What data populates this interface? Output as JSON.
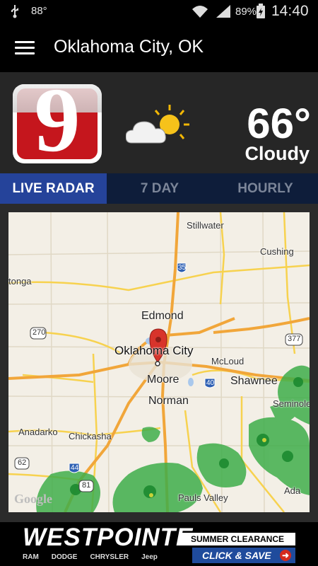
{
  "status_bar": {
    "temperature": "88°",
    "battery": "89%",
    "time": "14:40"
  },
  "app_bar": {
    "location": "Oklahoma City, OK"
  },
  "current": {
    "station_logo": "9",
    "temperature": "66°",
    "condition": "Cloudy",
    "icon": "partly-cloudy-icon"
  },
  "tabs": [
    {
      "label": "LIVE RADAR",
      "active": true
    },
    {
      "label": "7 DAY",
      "active": false
    },
    {
      "label": "HOURLY",
      "active": false
    }
  ],
  "map": {
    "labels": {
      "stillwater": "Stillwater",
      "cushing": "Cushing",
      "tonga": "tonga",
      "edmond": "Edmond",
      "okc": "Oklahoma City",
      "mcloud": "McLoud",
      "shawnee": "Shawnee",
      "moore": "Moore",
      "norman": "Norman",
      "seminole": "Seminole",
      "anadarko": "Anadarko",
      "chickasha": "Chickasha",
      "pauls_valley": "Pauls Valley",
      "ada": "Ada",
      "google": "Google"
    },
    "shields": {
      "i35": "35",
      "us270": "270",
      "us377": "377",
      "i40": "40",
      "us62": "62",
      "i44": "44",
      "us81": "81"
    }
  },
  "ad": {
    "brand": "WESTPOINTE",
    "makes": [
      "RAM",
      "DODGE",
      "CHRYSLER",
      "Jeep"
    ],
    "event": "SUMMER CLEARANCE EVENT",
    "cta": "CLICK & SAVE"
  },
  "colors": {
    "tab_active": "#25439a",
    "tab_bar": "#0e1d3a",
    "logo_red": "#c5161d",
    "radar_green": "#2fa84f"
  }
}
